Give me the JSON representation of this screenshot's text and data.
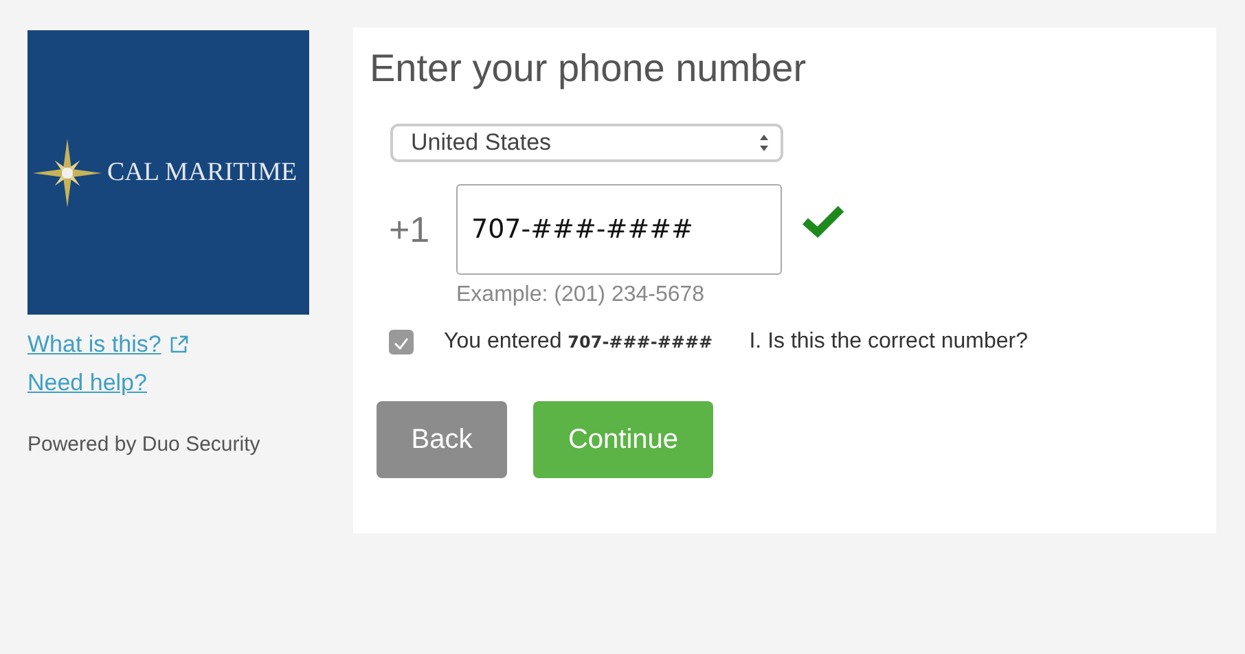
{
  "sidebar": {
    "logo_text": "CAL MARITIME",
    "links": [
      {
        "label": "What is this?",
        "external": true
      },
      {
        "label": "Need help?",
        "external": false
      }
    ],
    "powered_by": "Powered by Duo Security"
  },
  "form": {
    "title": "Enter your phone number",
    "country": "United States",
    "country_code": "+1",
    "phone_value": "707-###-####",
    "valid": true,
    "example": "Example: (201) 234-5678",
    "confirm": {
      "checked": true,
      "text": "You entered **707-###-####**      I. Is this the correct number?"
    },
    "buttons": [
      {
        "label": "Back",
        "kind": "secondary"
      },
      {
        "label": "Continue",
        "kind": "primary"
      }
    ]
  }
}
